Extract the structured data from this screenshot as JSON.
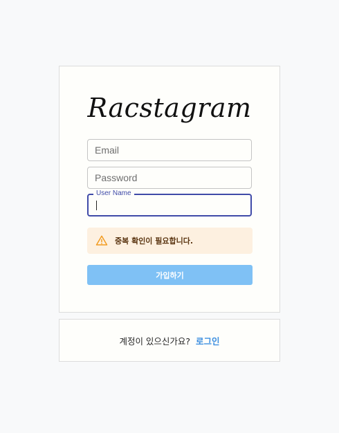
{
  "app": {
    "logo_text": "Racstagram"
  },
  "form": {
    "email": {
      "placeholder": "Email",
      "value": ""
    },
    "password": {
      "placeholder": "Password",
      "value": ""
    },
    "username": {
      "label": "User Name",
      "value": ""
    }
  },
  "alert": {
    "icon": "warning-icon",
    "message": "중복 확인이 필요합니다.",
    "color": "#f29b20"
  },
  "signup_button": {
    "label": "가입하기",
    "color": "#7fc1f5"
  },
  "login_prompt": {
    "question": "계정이 있으신가요?",
    "link_label": "로그인",
    "link_color": "#3d8fe0"
  }
}
